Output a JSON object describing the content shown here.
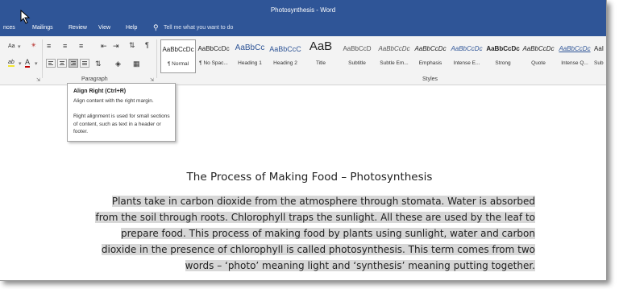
{
  "window": {
    "title": "Photosynthesis - Word"
  },
  "menu": {
    "items": [
      "nces",
      "Mailings",
      "Review",
      "View",
      "Help"
    ],
    "tell_me": "Tell me what you want to do"
  },
  "ribbon": {
    "groups": {
      "paragraph": "Paragraph",
      "styles": "Styles"
    },
    "font_tools": {
      "font_size_label": "Aa",
      "highlight_label": "ab",
      "font_color_label": "A"
    },
    "styles": [
      {
        "sample": "AaBbCcDc",
        "name": "¶ Normal"
      },
      {
        "sample": "AaBbCcDc",
        "name": "¶ No Spac..."
      },
      {
        "sample": "AaBbCc",
        "name": "Heading 1"
      },
      {
        "sample": "AaBbCcC",
        "name": "Heading 2"
      },
      {
        "sample": "AaB",
        "name": "Title"
      },
      {
        "sample": "AaBbCcD",
        "name": "Subtitle"
      },
      {
        "sample": "AaBbCcDc",
        "name": "Subtle Em..."
      },
      {
        "sample": "AaBbCcDc",
        "name": "Emphasis"
      },
      {
        "sample": "AaBbCcDc",
        "name": "Intense E..."
      },
      {
        "sample": "AaBbCcDc",
        "name": "Strong"
      },
      {
        "sample": "AaBbCcDc",
        "name": "Quote"
      },
      {
        "sample": "AaBbCcDc",
        "name": "Intense Q..."
      },
      {
        "sample": "AaI",
        "name": "Sub"
      }
    ]
  },
  "tooltip": {
    "title": "Align Right (Ctrl+R)",
    "line1": "Align content with the right margin.",
    "body": "Right alignment is used for small sections of content, such as text in a header or footer."
  },
  "document": {
    "title": "The Process of Making Food – Photosynthesis",
    "lines": [
      "Plants take in carbon dioxide from the atmosphere through stomata. Water is absorbed",
      "from the soil through roots. Chlorophyll traps the sunlight. All these are used by the leaf to",
      "prepare food. This process of making food by plants using sunlight, water and carbon",
      "dioxide in the presence of chlorophyll is called photosynthesis. This term comes from two",
      "words – ‘photo’ meaning light and ‘synthesis’ meaning putting together."
    ]
  },
  "colors": {
    "title_bar": "#2f5597",
    "ribbon": "#f3f3f3",
    "selection": "#d7d7d7"
  }
}
